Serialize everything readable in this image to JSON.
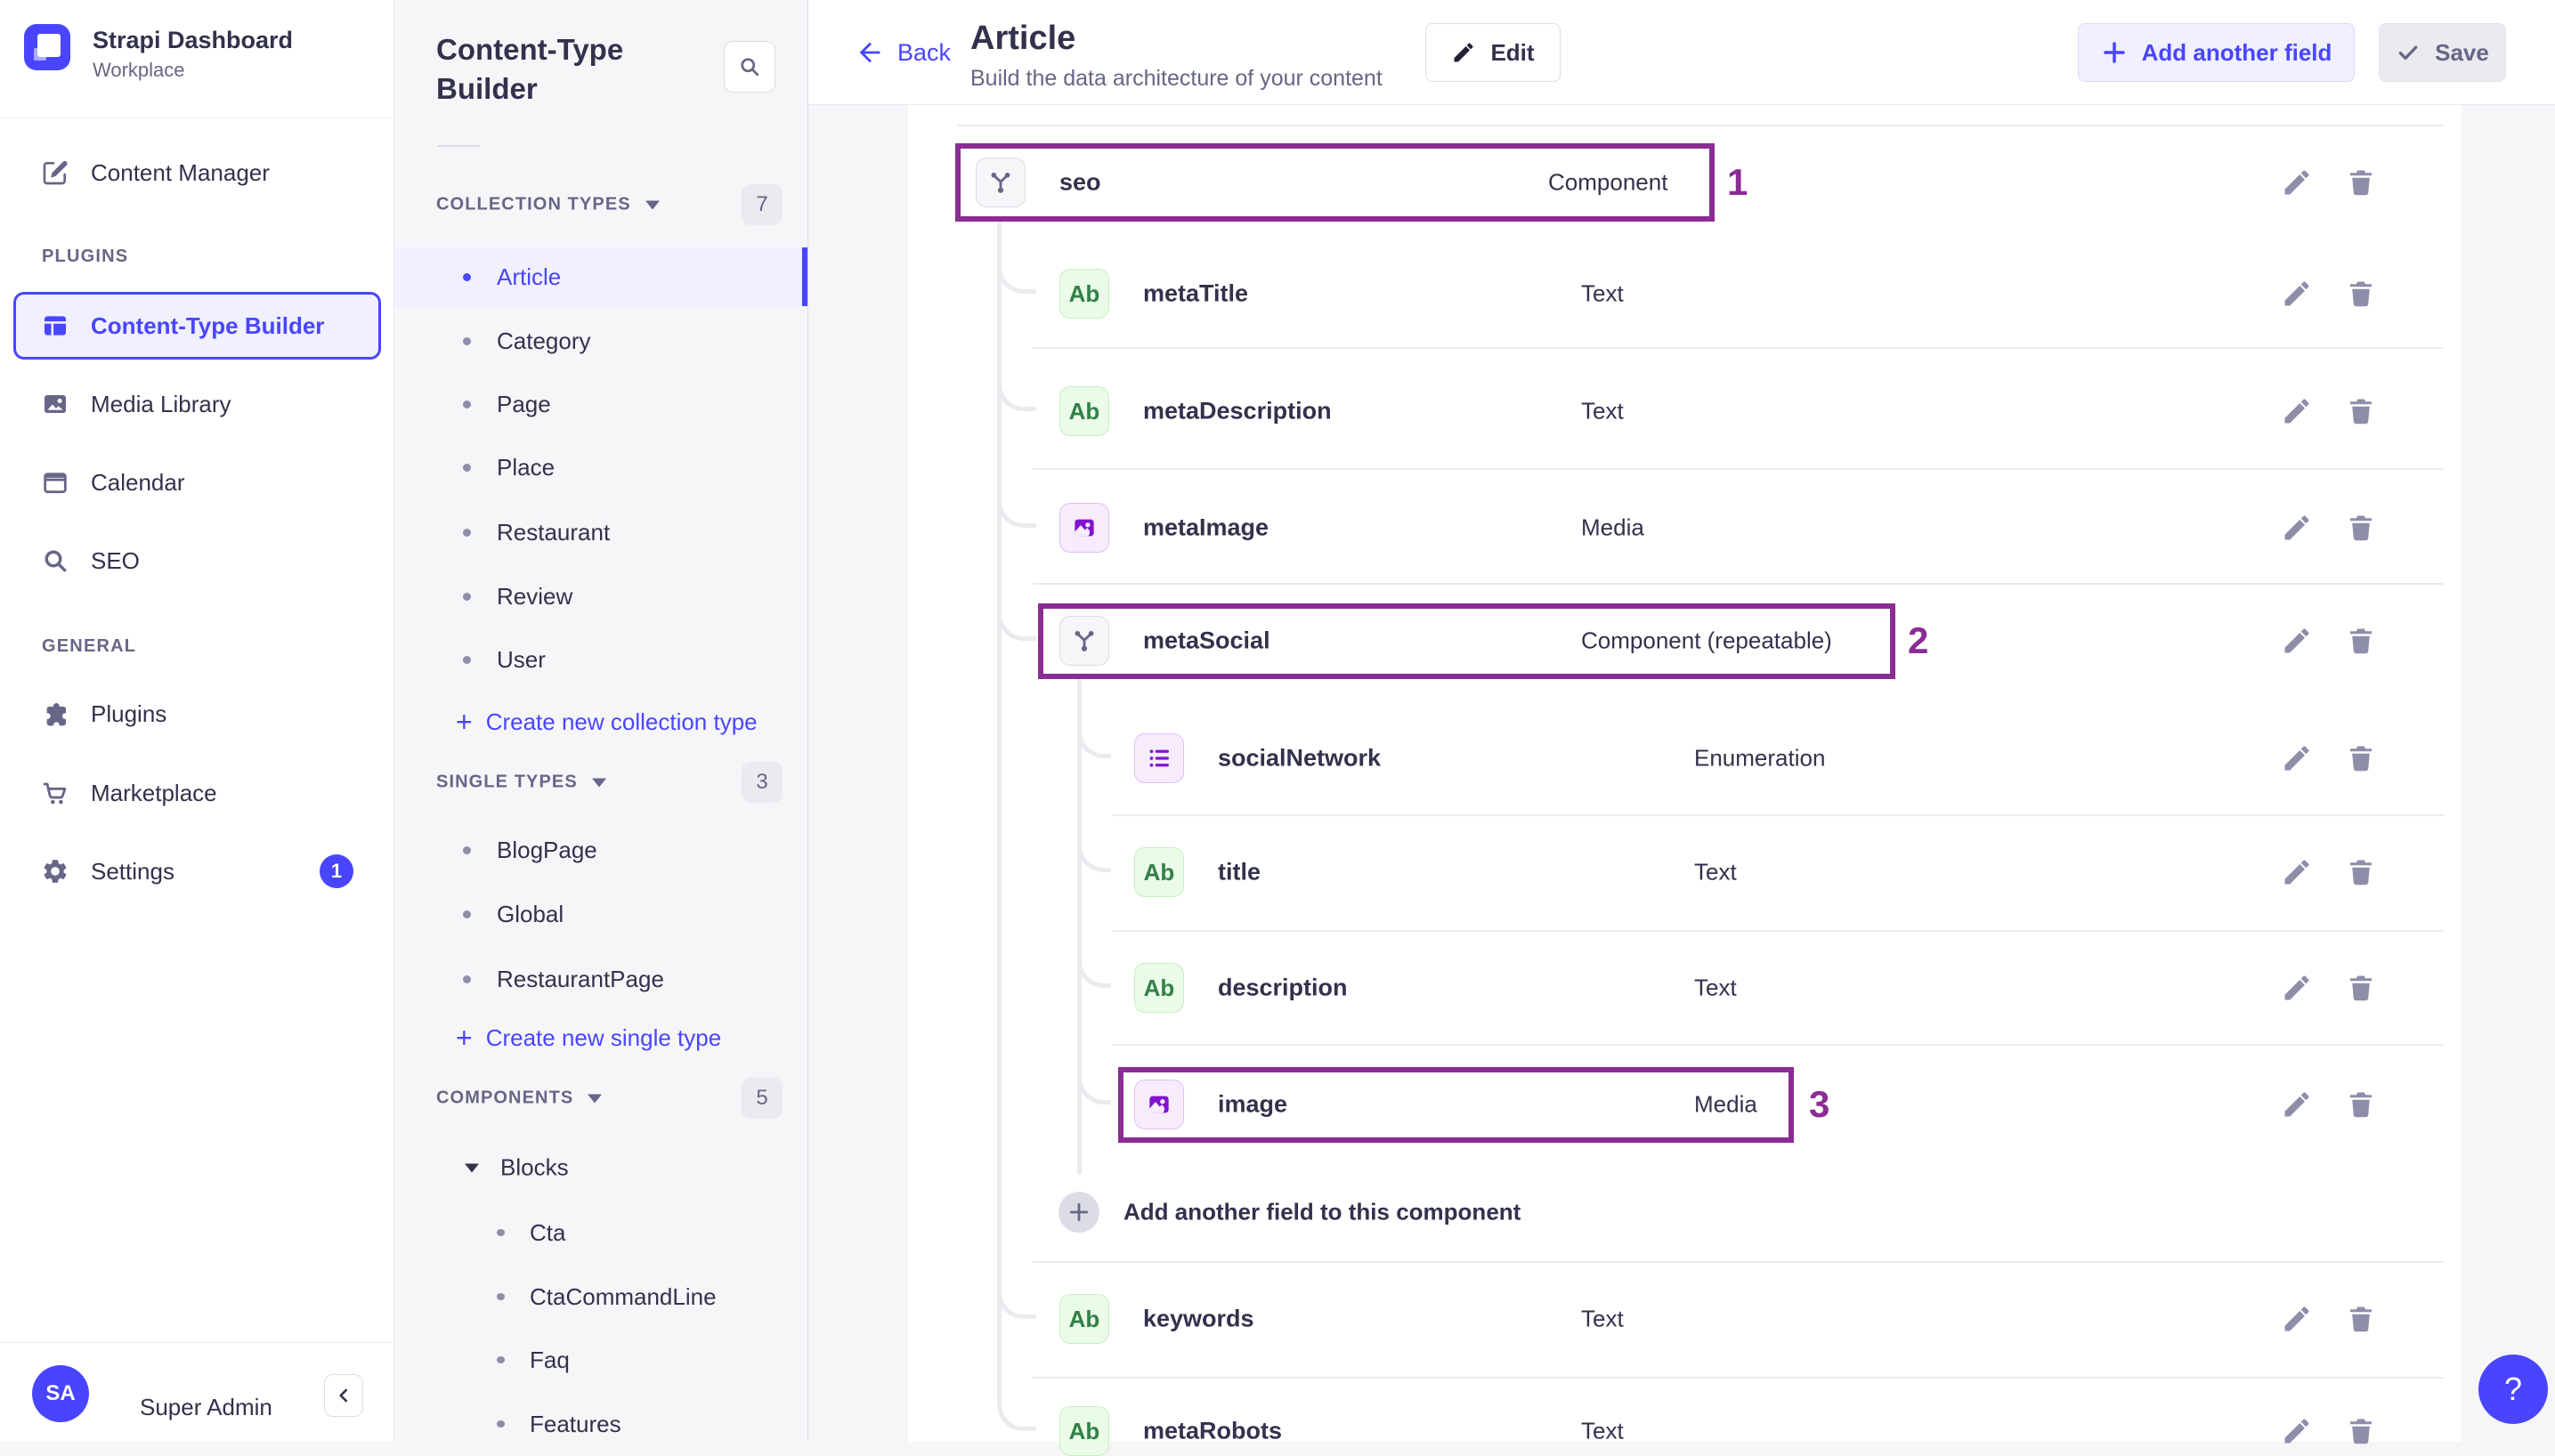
{
  "colors": {
    "accent": "#4945FF",
    "annotation": "#8A2C93",
    "text": "#32324D",
    "muted": "#666687",
    "field_green": "#328048",
    "field_purple": "#8312D1"
  },
  "sidebar": {
    "app_name": "Strapi Dashboard",
    "workspace": "Workplace",
    "sections": [
      {
        "label": "",
        "items": [
          {
            "label": "Content Manager",
            "icon": "write-icon"
          }
        ]
      },
      {
        "label": "PLUGINS",
        "items": [
          {
            "label": "Content-Type Builder",
            "icon": "layout-icon",
            "active": true
          },
          {
            "label": "Media Library",
            "icon": "picture-icon"
          },
          {
            "label": "Calendar",
            "icon": "calendar-icon"
          },
          {
            "label": "SEO",
            "icon": "search-icon"
          }
        ]
      },
      {
        "label": "GENERAL",
        "items": [
          {
            "label": "Plugins",
            "icon": "puzzle-icon"
          },
          {
            "label": "Marketplace",
            "icon": "cart-icon"
          },
          {
            "label": "Settings",
            "icon": "gear-icon",
            "badge": "1"
          }
        ]
      }
    ],
    "user": {
      "initials": "SA",
      "name": "Super Admin"
    }
  },
  "panel": {
    "title": "Content-Type Builder",
    "sections": [
      {
        "header": "COLLECTION TYPES",
        "count": "7",
        "items": [
          "Article",
          "Category",
          "Page",
          "Place",
          "Restaurant",
          "Review",
          "User"
        ],
        "active_item": "Article",
        "action": "Create new collection type"
      },
      {
        "header": "SINGLE TYPES",
        "count": "3",
        "items": [
          "BlogPage",
          "Global",
          "RestaurantPage"
        ],
        "action": "Create new single type"
      },
      {
        "header": "COMPONENTS",
        "count": "5",
        "group": "Blocks",
        "group_items": [
          "Cta",
          "CtaCommandLine",
          "Faq",
          "Features"
        ]
      }
    ]
  },
  "header": {
    "back": "Back",
    "title": "Article",
    "subtitle": "Build the data architecture of your content",
    "edit": "Edit",
    "add_field": "Add another field",
    "save": "Save"
  },
  "builder": {
    "rows": [
      {
        "name": "seo",
        "type": "Component",
        "icon": "component",
        "level": 0,
        "annotation": "1"
      },
      {
        "name": "metaTitle",
        "type": "Text",
        "icon": "text",
        "level": 1
      },
      {
        "name": "metaDescription",
        "type": "Text",
        "icon": "text",
        "level": 1
      },
      {
        "name": "metaImage",
        "type": "Media",
        "icon": "media",
        "level": 1
      },
      {
        "name": "metaSocial",
        "type": "Component (repeatable)",
        "icon": "component",
        "level": 1,
        "annotation": "2"
      },
      {
        "name": "socialNetwork",
        "type": "Enumeration",
        "icon": "enumeration",
        "level": 2
      },
      {
        "name": "title",
        "type": "Text",
        "icon": "text",
        "level": 2
      },
      {
        "name": "description",
        "type": "Text",
        "icon": "text",
        "level": 2
      },
      {
        "name": "image",
        "type": "Media",
        "icon": "media",
        "level": 2,
        "annotation": "3"
      },
      {
        "name": "keywords",
        "type": "Text",
        "icon": "text",
        "level": 1
      },
      {
        "name": "metaRobots",
        "type": "Text",
        "icon": "text",
        "level": 1
      }
    ],
    "add_component_field": "Add another field to this component"
  },
  "help_label": "?"
}
